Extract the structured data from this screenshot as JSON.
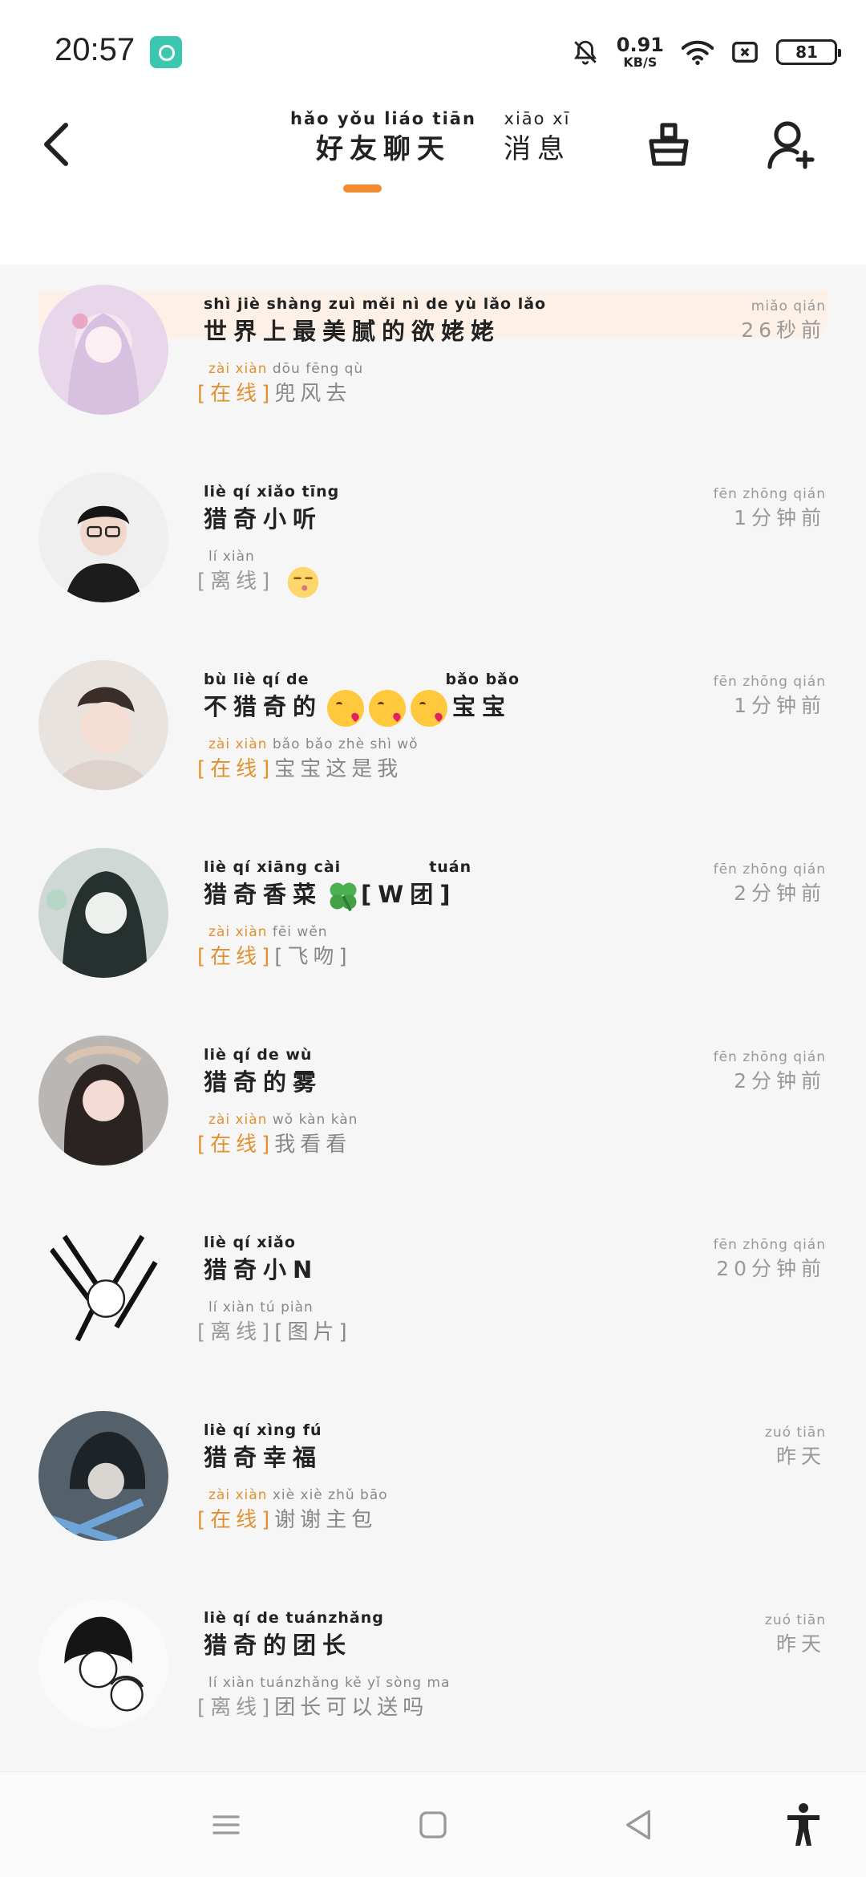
{
  "status_bar": {
    "time": "20:57",
    "net_speed_value": "0.91",
    "net_speed_unit": "KB/S",
    "battery": "81"
  },
  "header": {
    "tabs": [
      {
        "pinyin": "hǎo yǒu liáo tiān",
        "label": "好友聊天",
        "active": true
      },
      {
        "pinyin": "xiāo xī",
        "label": "消息",
        "active": false
      }
    ]
  },
  "chats": [
    {
      "name_pinyin": "shì jiè shàng zuì měi nì de yù lǎo lǎo",
      "name": "世界上最美腻的欲姥姥",
      "status_pinyin": "zài xiàn",
      "status": "[在线]",
      "status_type": "online",
      "msg_pinyin": "dōu fēng qù",
      "msg": "兜风去",
      "time_pinyin": "miǎo qián",
      "time": "26秒前"
    },
    {
      "name_pinyin": "liè qí xiǎo tīng",
      "name": "猎奇小听",
      "status_pinyin": "lí xiàn",
      "status": "[离线]",
      "status_type": "offline",
      "msg_pinyin": "",
      "msg": "",
      "time_pinyin": "fēn zhōng qián",
      "time": "1分钟前"
    },
    {
      "name_pinyin": "bù liè qí de",
      "name": "不猎奇的",
      "name_suffix_pinyin": "bǎo bǎo",
      "name_suffix": "宝宝",
      "status_pinyin": "zài xiàn",
      "status": "[在线]",
      "status_type": "online",
      "msg_pinyin": "bǎo bǎo zhè shì wǒ",
      "msg": "宝宝这是我",
      "time_pinyin": "fēn zhōng qián",
      "time": "1分钟前"
    },
    {
      "name_pinyin": "liè qí xiāng cài",
      "name": "猎奇香菜",
      "name_suffix_pinyin": "tuán",
      "name_suffix": "[W团]",
      "status_pinyin": "zài xiàn",
      "status": "[在线]",
      "status_type": "online",
      "msg_pinyin": "fēi wěn",
      "msg": "[飞吻]",
      "time_pinyin": "fēn zhōng qián",
      "time": "2分钟前"
    },
    {
      "name_pinyin": "liè qí de wù",
      "name": "猎奇的雾",
      "status_pinyin": "zài xiàn",
      "status": "[在线]",
      "status_type": "online",
      "msg_pinyin": "wǒ kàn kàn",
      "msg": "我看看",
      "time_pinyin": "fēn zhōng qián",
      "time": "2分钟前"
    },
    {
      "name_pinyin": "liè qí xiǎo",
      "name": "猎奇小N",
      "status_pinyin": "lí xiàn",
      "status": "[离线]",
      "status_type": "offline",
      "msg_pinyin": "tú piàn",
      "msg": "[图片]",
      "time_pinyin": "fēn zhōng qián",
      "time": "20分钟前"
    },
    {
      "name_pinyin": "liè qí xìng fú",
      "name": "猎奇幸福",
      "status_pinyin": "zài xiàn",
      "status": "[在线]",
      "status_type": "online",
      "msg_pinyin": "xiè xiè zhǔ bāo",
      "msg": "谢谢主包",
      "time_pinyin": "zuó tiān",
      "time": "昨天"
    },
    {
      "name_pinyin": "liè qí de tuánzhǎng",
      "name": "猎奇的团长",
      "status_pinyin": "lí xiàn",
      "status": "[离线]",
      "status_type": "offline",
      "msg_pinyin": "tuánzhǎng kě yǐ sòng ma",
      "msg": "团长可以送吗",
      "time_pinyin": "zuó tiān",
      "time": "昨天"
    }
  ],
  "colors": {
    "accent": "#f28a32",
    "online": "#e3912f",
    "muted": "#999999",
    "banner": "#fdf0e7"
  }
}
